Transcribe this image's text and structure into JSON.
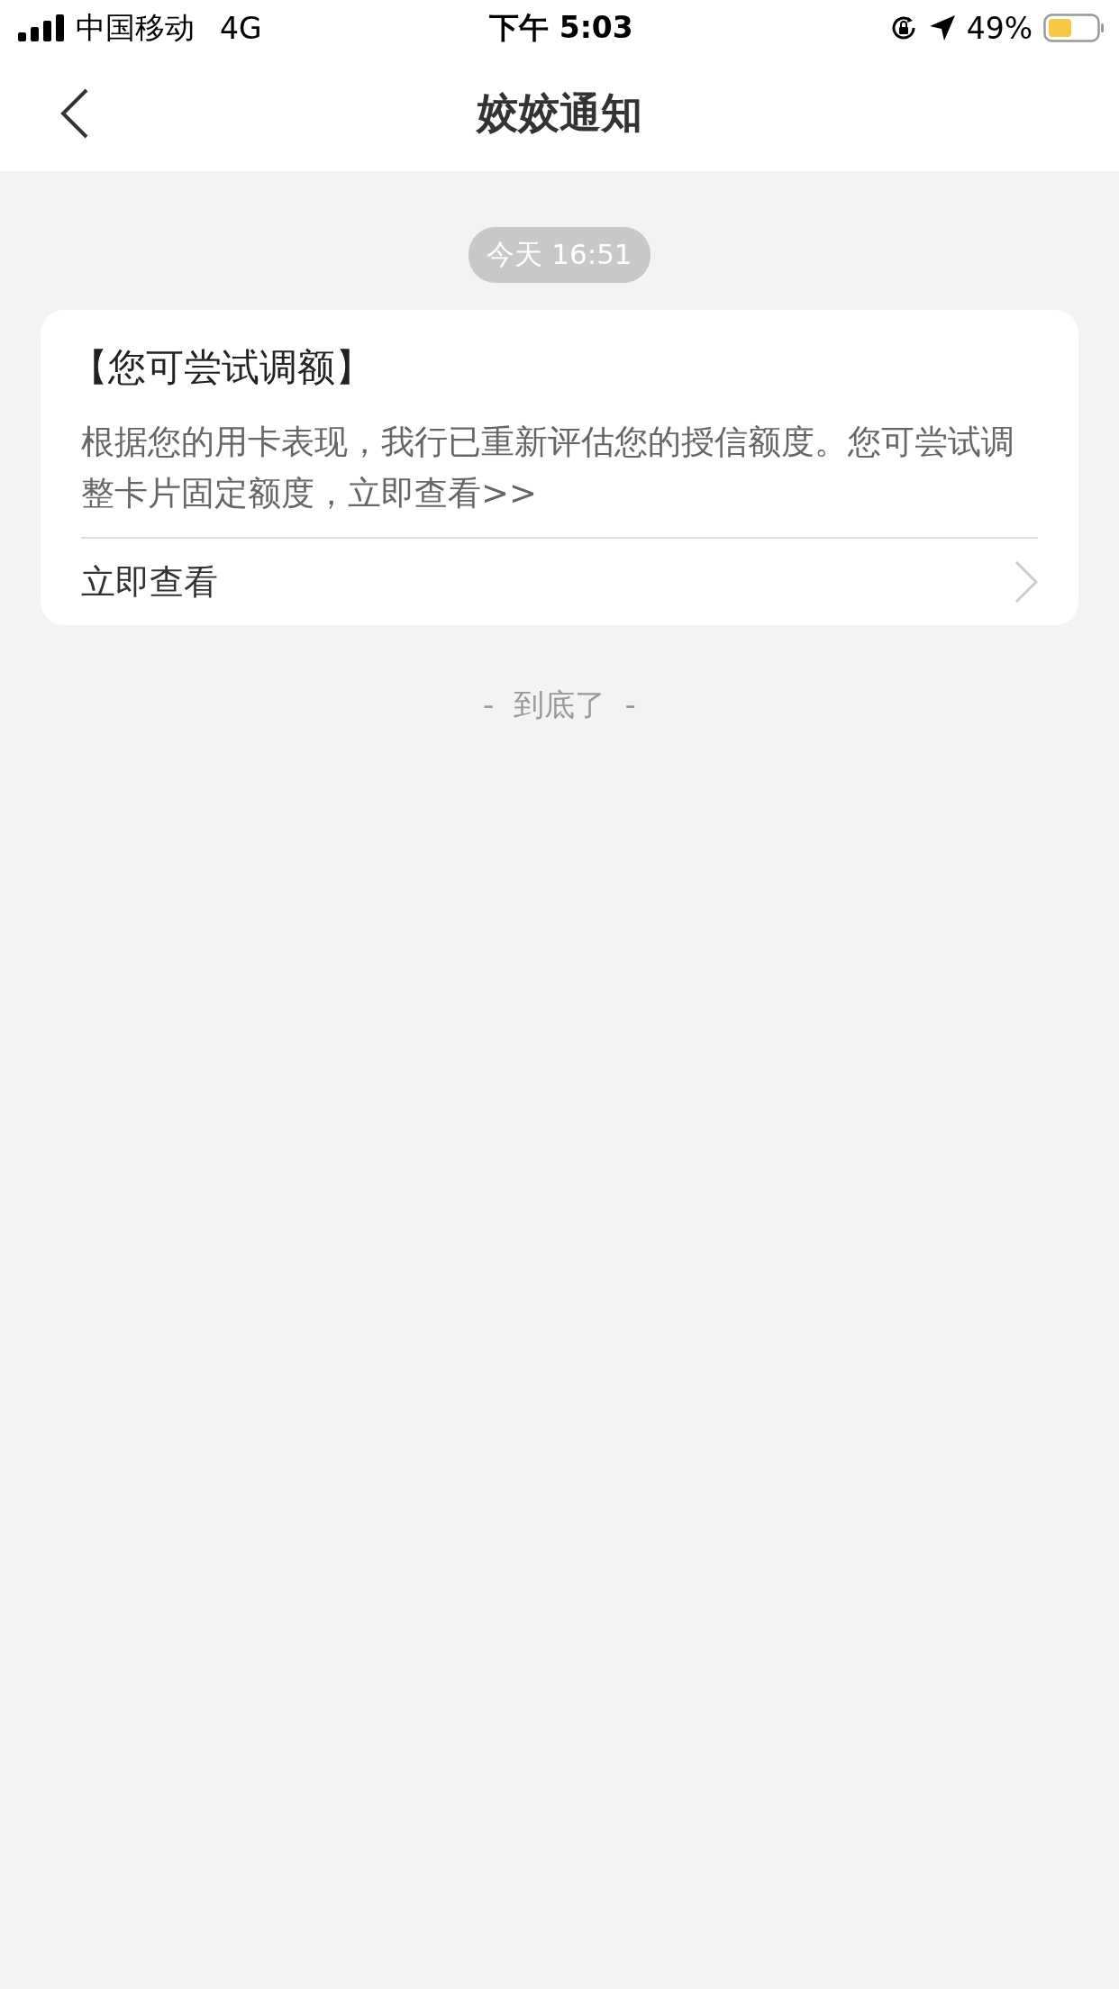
{
  "status_bar": {
    "carrier": "中国移动",
    "network": "4G",
    "time": "下午 5:03",
    "battery": "49%"
  },
  "nav": {
    "title": "姣姣通知"
  },
  "messages": [
    {
      "time": "今天 16:51",
      "title": "【您可尝试调额】",
      "body": "根据您的用卡表现，我行已重新评估您的授信额度。您可尝试调整卡片固定额度，立即查看>>",
      "link": "立即查看"
    }
  ],
  "footer": "-  到底了  -"
}
